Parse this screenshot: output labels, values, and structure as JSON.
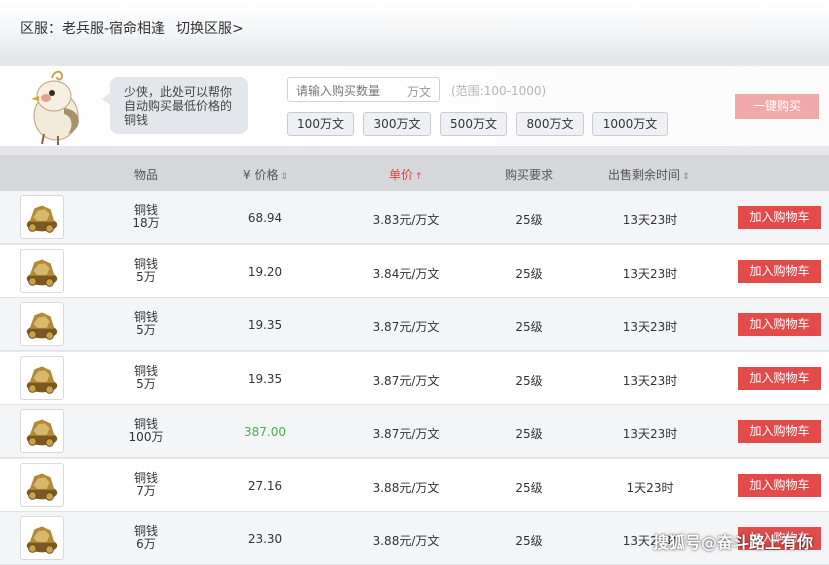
{
  "header": {
    "server_label": "区服：老兵服-宿命相逢",
    "switch_label": "切换区服>"
  },
  "assistant": {
    "message_lines": [
      "少侠，此处可以帮你",
      "自动购买最低价格的",
      "铜钱"
    ]
  },
  "purchase": {
    "input_placeholder": "请输入购买数量",
    "input_unit": "万文",
    "range_hint": "(范围:100-1000)",
    "presets": [
      "100万文",
      "300万文",
      "500万文",
      "800万文",
      "1000万文"
    ],
    "buy_all_label": "一键购买"
  },
  "table": {
    "columns": {
      "item": "物品",
      "price": "¥ 价格",
      "unit": "单价",
      "req": "购买要求",
      "time": "出售剩余时间"
    },
    "sort_icons": {
      "price": "⇕",
      "unit": "↑",
      "time": "⇕"
    },
    "active_sort_color": "#e04040",
    "cart_label": "加入购物车",
    "rows": [
      {
        "item": "铜钱",
        "amount": "18万",
        "price": "68.94",
        "unit": "3.83元/万文",
        "req": "25级",
        "time": "13天23时",
        "highlight": false
      },
      {
        "item": "铜钱",
        "amount": "5万",
        "price": "19.20",
        "unit": "3.84元/万文",
        "req": "25级",
        "time": "13天23时",
        "highlight": false
      },
      {
        "item": "铜钱",
        "amount": "5万",
        "price": "19.35",
        "unit": "3.87元/万文",
        "req": "25级",
        "time": "13天23时",
        "highlight": false
      },
      {
        "item": "铜钱",
        "amount": "5万",
        "price": "19.35",
        "unit": "3.87元/万文",
        "req": "25级",
        "time": "13天23时",
        "highlight": false
      },
      {
        "item": "铜钱",
        "amount": "100万",
        "price": "387.00",
        "unit": "3.87元/万文",
        "req": "25级",
        "time": "13天23时",
        "highlight": true
      },
      {
        "item": "铜钱",
        "amount": "7万",
        "price": "27.16",
        "unit": "3.88元/万文",
        "req": "25级",
        "time": "1天23时",
        "highlight": false
      },
      {
        "item": "铜钱",
        "amount": "6万",
        "price": "23.30",
        "unit": "3.88元/万文",
        "req": "25级",
        "time": "13天23时",
        "highlight": false
      }
    ]
  },
  "watermark": "搜狐号@奋斗路上有你"
}
